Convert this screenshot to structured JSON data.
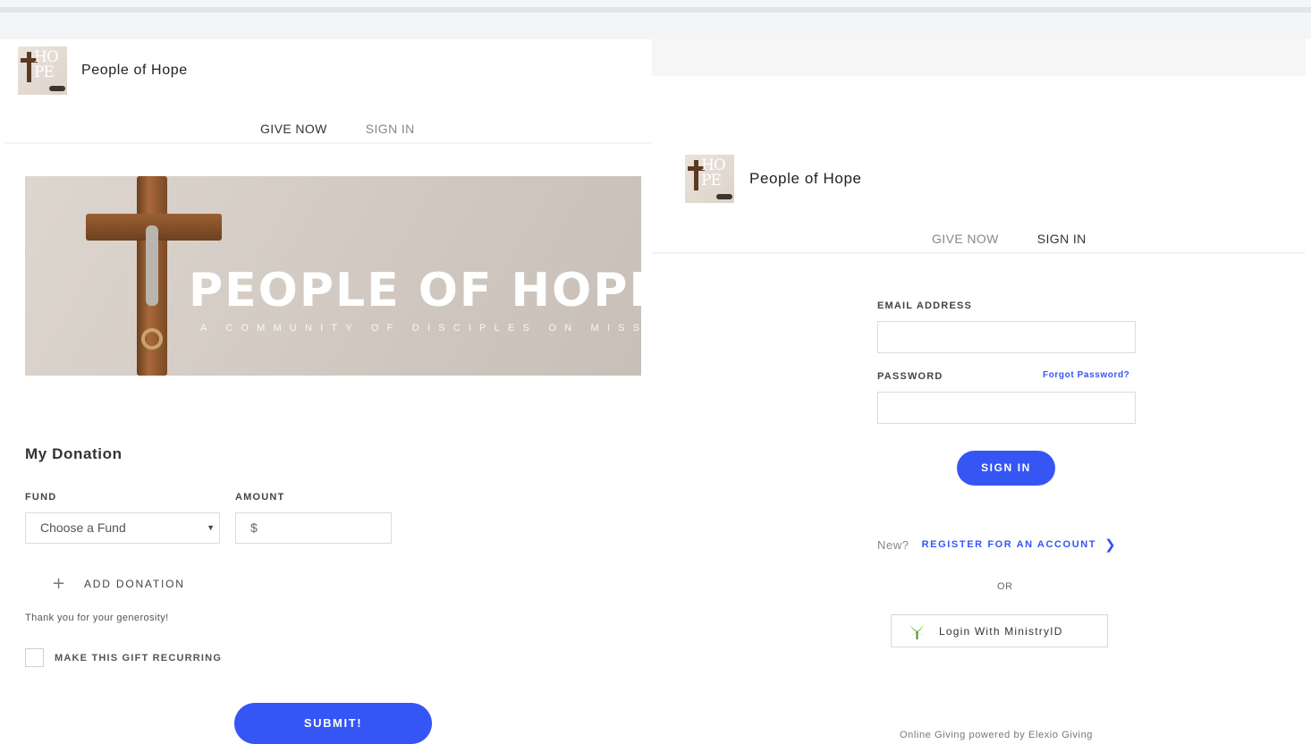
{
  "left": {
    "brand": {
      "name": "People of Hope",
      "logo_text_top": "HO",
      "logo_text_bottom": "PE"
    },
    "nav": {
      "give_now": "GIVE NOW",
      "sign_in": "SIGN IN"
    },
    "banner": {
      "title": "PEOPLE OF HOPE",
      "subtitle": "A COMMUNITY OF DISCIPLES ON MISSION"
    },
    "donation": {
      "title": "My Donation",
      "fund_label": "FUND",
      "fund_value": "Choose a Fund",
      "amount_label": "AMOUNT",
      "amount_prefix": "$",
      "add_donation": "ADD DONATION",
      "thanks": "Thank you for your generosity!",
      "recurring_label": "MAKE THIS GIFT RECURRING",
      "submit": "SUBMIT!"
    }
  },
  "right": {
    "brand": {
      "name": "People of Hope",
      "logo_text_top": "HO",
      "logo_text_bottom": "PE"
    },
    "nav": {
      "give_now": "GIVE NOW",
      "sign_in": "SIGN IN"
    },
    "form": {
      "email_label": "EMAIL ADDRESS",
      "email_value": "",
      "password_label": "PASSWORD",
      "password_value": "",
      "forgot": "Forgot Password?",
      "signin": "SIGN IN",
      "new_prefix": "New?",
      "register": "REGISTER FOR AN ACCOUNT",
      "chevron": "❯",
      "or": "OR",
      "ministry_login": "Login With MinistryID",
      "powered": "Online Giving powered by Elexio Giving"
    }
  },
  "colors": {
    "accent": "#3555f5",
    "ministry_green": "#6dbb2e",
    "text": "#333333"
  },
  "icons": {
    "add": "plus-icon",
    "dropdown": "chevron-down-icon",
    "register": "chevron-right-icon",
    "ministry": "ministryid-leaf-icon"
  }
}
